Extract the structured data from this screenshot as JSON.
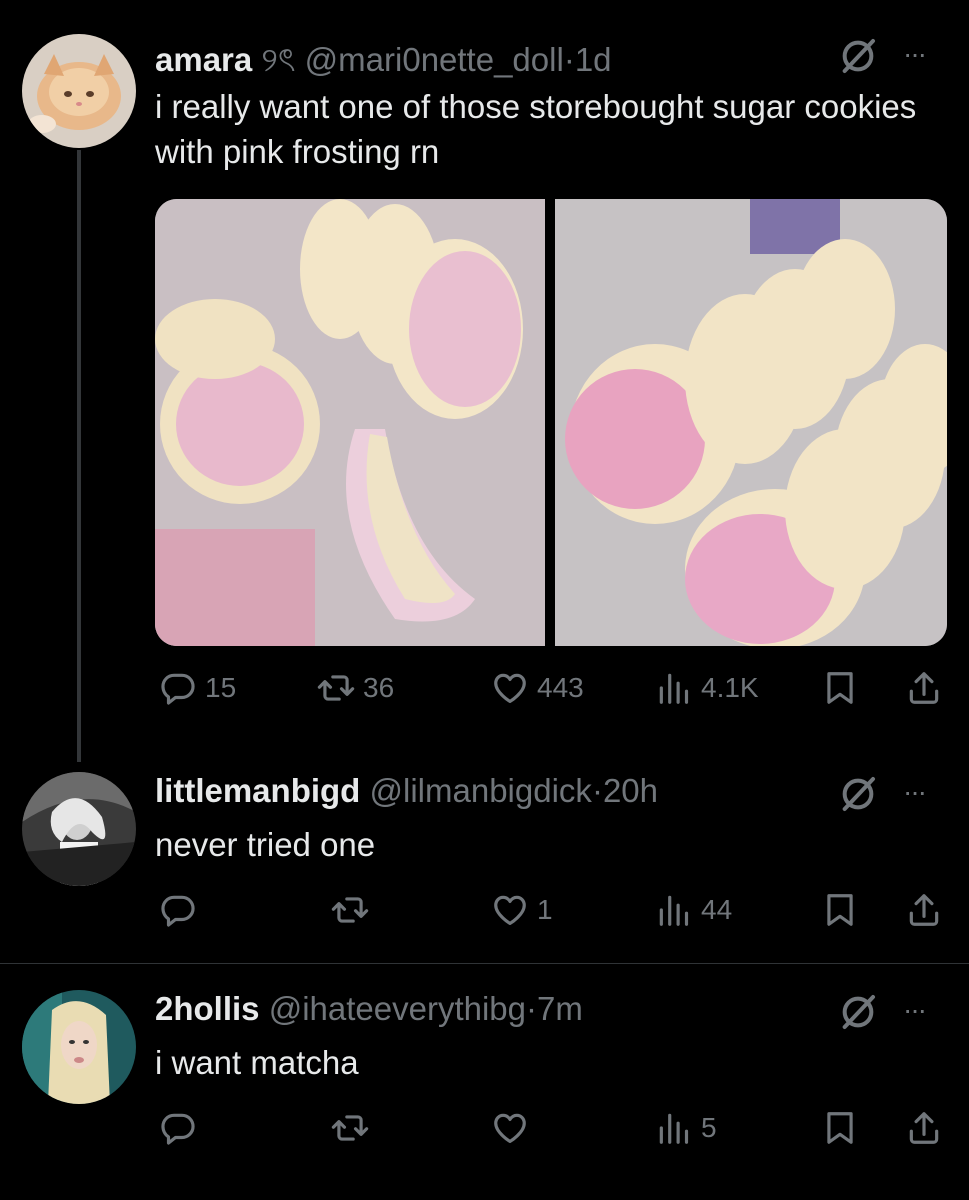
{
  "tweets": [
    {
      "name": "amara",
      "name_glyph": "୨ৎ",
      "handle": "@mari0nette_doll",
      "sep": "·",
      "time": "1d",
      "text": "i really want one of those storebought sugar cookies with pink frosting rn",
      "replies": "15",
      "reposts": "36",
      "likes": "443",
      "views": "4.1K"
    },
    {
      "name": "littlemanbigd",
      "handle": "@lilmanbigdick",
      "sep": "·",
      "time": "20h",
      "text": "never tried one",
      "replies": "",
      "reposts": "",
      "likes": "1",
      "views": "44"
    },
    {
      "name": "2hollis",
      "handle": "@ihateeverythibg",
      "sep": "·",
      "time": "7m",
      "text": "i want matcha",
      "replies": "",
      "reposts": "",
      "likes": "",
      "views": "5"
    }
  ],
  "icons": {
    "more": "···",
    "grok": "grok-icon",
    "reply": "reply-icon",
    "repost": "repost-icon",
    "like": "like-icon",
    "views": "views-icon",
    "bookmark": "bookmark-icon",
    "share": "share-icon"
  },
  "colors": {
    "background": "#000000",
    "text": "#e7e9ea",
    "muted": "#71767b",
    "divider": "#2f3336"
  }
}
